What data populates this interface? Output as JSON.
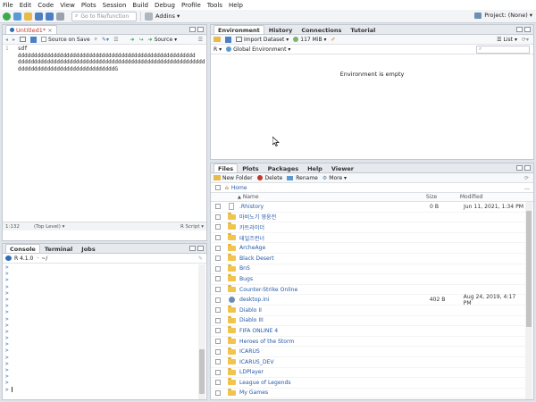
{
  "menubar": [
    "File",
    "Edit",
    "Code",
    "View",
    "Plots",
    "Session",
    "Build",
    "Debug",
    "Profile",
    "Tools",
    "Help"
  ],
  "toolbar": {
    "goto_placeholder": "Go to file/function",
    "addins_label": "Addins",
    "project_label": "Project: (None)"
  },
  "editor": {
    "tab_label": "Untitled1*",
    "source_on_save": "Source on Save",
    "source_label": "Source",
    "lines": [
      {
        "num": "1",
        "text": "sdf ddddddddddddddddddddddddddddddddddddddddddddddddddddddd"
      },
      {
        "num": "",
        "text": "dddddddddddddddddddddddddddddddddddddddddddddddddddddddddd"
      },
      {
        "num": "",
        "text": "ddddddddddddddddddddddddddddddG"
      }
    ],
    "status_pos": "1:132",
    "status_level": "(Top Level)",
    "status_type": "R Script"
  },
  "console": {
    "tabs": [
      "Console",
      "Terminal",
      "Jobs"
    ],
    "version": "R 4.1.0",
    "path": "~/",
    "prompt": ">",
    "prompt_count": 20
  },
  "environment": {
    "tabs": [
      "Environment",
      "History",
      "Connections",
      "Tutorial"
    ],
    "import_label": "Import Dataset",
    "memory": "117 MiB",
    "list_label": "List",
    "r_label": "R",
    "scope_label": "Global Environment",
    "search_placeholder": "",
    "empty_message": "Environment is empty"
  },
  "files": {
    "tabs": [
      "Files",
      "Plots",
      "Packages",
      "Help",
      "Viewer"
    ],
    "new_folder": "New Folder",
    "delete": "Delete",
    "rename": "Rename",
    "more": "More",
    "breadcrumb": "Home",
    "col_name": "Name",
    "col_size": "Size",
    "col_modified": "Modified",
    "rows": [
      {
        "name": ".Rhistory",
        "type": "file",
        "size": "0 B",
        "modified": "Jun 11, 2021, 1:34 PM"
      },
      {
        "name": "마비노기 영웅전",
        "type": "folder",
        "size": "",
        "modified": ""
      },
      {
        "name": "카트라이더",
        "type": "folder",
        "size": "",
        "modified": ""
      },
      {
        "name": "테일즈런너",
        "type": "folder",
        "size": "",
        "modified": ""
      },
      {
        "name": "ArcheAge",
        "type": "folder",
        "size": "",
        "modified": ""
      },
      {
        "name": "Black Desert",
        "type": "folder",
        "size": "",
        "modified": ""
      },
      {
        "name": "BnS",
        "type": "folder",
        "size": "",
        "modified": ""
      },
      {
        "name": "Bugs",
        "type": "folder",
        "size": "",
        "modified": ""
      },
      {
        "name": "Counter-Strike Online",
        "type": "folder",
        "size": "",
        "modified": ""
      },
      {
        "name": "desktop.ini",
        "type": "config",
        "size": "402 B",
        "modified": "Aug 24, 2019, 4:17 PM"
      },
      {
        "name": "Diablo II",
        "type": "folder",
        "size": "",
        "modified": ""
      },
      {
        "name": "Diablo III",
        "type": "folder",
        "size": "",
        "modified": ""
      },
      {
        "name": "FIFA ONLINE 4",
        "type": "folder",
        "size": "",
        "modified": ""
      },
      {
        "name": "Heroes of the Storm",
        "type": "folder",
        "size": "",
        "modified": ""
      },
      {
        "name": "ICARUS",
        "type": "folder",
        "size": "",
        "modified": ""
      },
      {
        "name": "ICARUS_DEV",
        "type": "folder",
        "size": "",
        "modified": ""
      },
      {
        "name": "LDPlayer",
        "type": "folder",
        "size": "",
        "modified": ""
      },
      {
        "name": "League of Legends",
        "type": "folder",
        "size": "",
        "modified": ""
      },
      {
        "name": "My Games",
        "type": "folder",
        "size": "",
        "modified": ""
      }
    ]
  }
}
